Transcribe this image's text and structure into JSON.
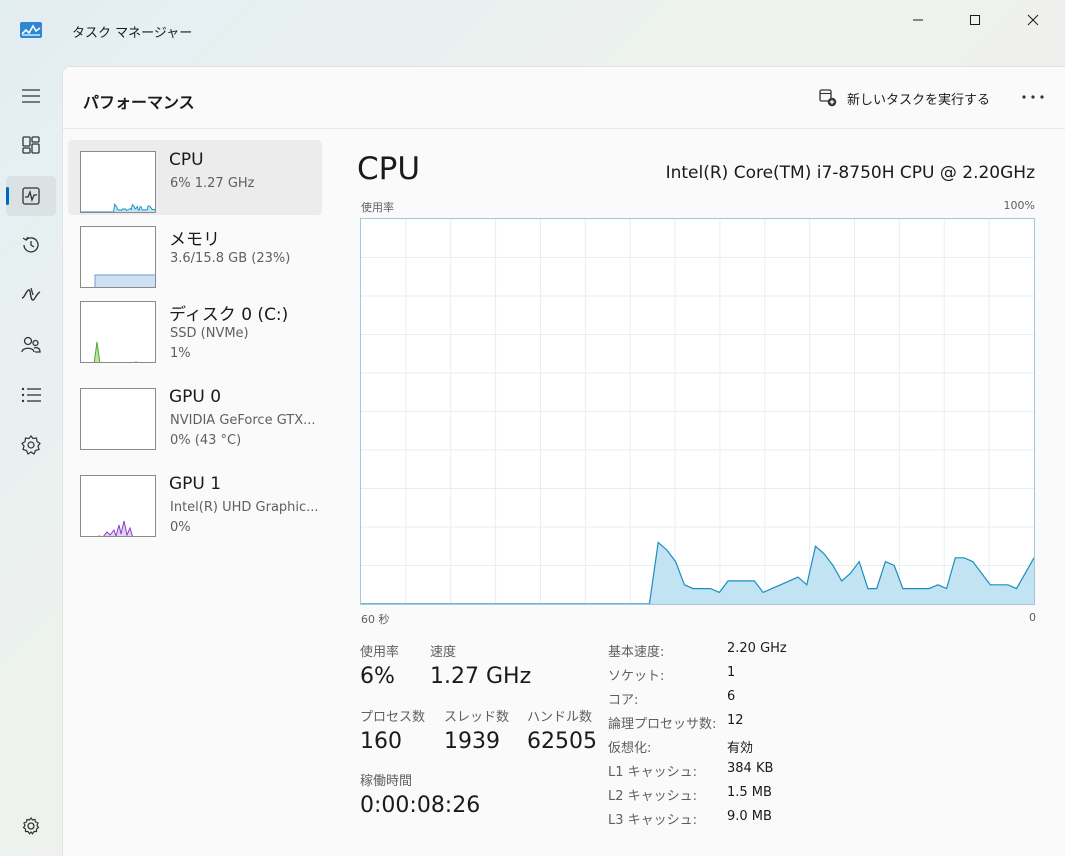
{
  "window": {
    "title": "タスク マネージャー"
  },
  "header": {
    "title": "パフォーマンス",
    "run_task_label": "新しいタスクを実行する"
  },
  "nav": {
    "items": [
      "menu-icon",
      "processes-icon",
      "performance-icon",
      "app-history-icon",
      "startup-icon",
      "users-icon",
      "details-icon",
      "services-icon",
      "settings-icon"
    ],
    "active": "performance-icon"
  },
  "devices": [
    {
      "name": "CPU",
      "sub1": "6% 1.27 GHz",
      "sub2": "",
      "color": "#1b8ec0",
      "selected": true
    },
    {
      "name": "メモリ",
      "sub1": "3.6/15.8 GB (23%)",
      "sub2": "",
      "color": "#6a9fd8",
      "selected": false
    },
    {
      "name": "ディスク 0 (C:)",
      "sub1": "SSD (NVMe)",
      "sub2": "1%",
      "color": "#4caa2b",
      "selected": false
    },
    {
      "name": "GPU 0",
      "sub1": "NVIDIA GeForce GTX...",
      "sub2": "0% (43 °C)",
      "color": "#8a3ec9",
      "selected": false
    },
    {
      "name": "GPU 1",
      "sub1": "Intel(R) UHD Graphic...",
      "sub2": "0%",
      "color": "#8a3ec9",
      "selected": false
    }
  ],
  "detail": {
    "title": "CPU",
    "model": "Intel(R) Core(TM) i7-8750H CPU @ 2.20GHz",
    "graph_top_left": "使用率",
    "graph_top_right": "100%",
    "graph_bottom_left": "60 秒",
    "graph_bottom_right": "0",
    "usage_label": "使用率",
    "usage_value": "6%",
    "speed_label": "速度",
    "speed_value": "1.27 GHz",
    "processes_label": "プロセス数",
    "processes_value": "160",
    "threads_label": "スレッド数",
    "threads_value": "1939",
    "handles_label": "ハンドル数",
    "handles_value": "62505",
    "uptime_label": "稼働時間",
    "uptime_value": "0:00:08:26",
    "specs": [
      {
        "label": "基本速度:",
        "value": "2.20 GHz"
      },
      {
        "label": "ソケット:",
        "value": "1"
      },
      {
        "label": "コア:",
        "value": "6"
      },
      {
        "label": "論理プロセッサ数:",
        "value": "12"
      },
      {
        "label": "仮想化:",
        "value": "有効"
      },
      {
        "label": "L1 キャッシュ:",
        "value": "384 KB"
      },
      {
        "label": "L2 キャッシュ:",
        "value": "1.5 MB"
      },
      {
        "label": "L3 キャッシュ:",
        "value": "9.0 MB"
      }
    ]
  },
  "cpu_history": [
    0,
    0,
    0,
    0,
    0,
    0,
    0,
    0,
    0,
    0,
    0,
    0,
    0,
    0,
    0,
    0,
    0,
    0,
    0,
    0,
    0,
    0,
    0,
    0,
    0,
    0,
    0,
    0,
    0,
    0,
    0,
    0,
    0,
    0,
    16,
    14,
    11,
    5,
    4,
    4,
    4,
    3,
    6,
    6,
    6,
    6,
    3,
    4,
    5,
    6,
    7,
    5,
    15,
    13,
    10,
    6,
    8,
    11,
    4,
    4,
    11,
    10,
    4,
    4,
    4,
    4,
    5,
    4,
    12,
    12,
    11,
    8,
    5,
    5,
    5,
    4,
    8,
    12
  ],
  "colors": {
    "accent": "#0067c0",
    "cpu_line": "#1b8ec0",
    "cpu_fill": "#c2e4f2",
    "grid": "#e7eef2"
  }
}
